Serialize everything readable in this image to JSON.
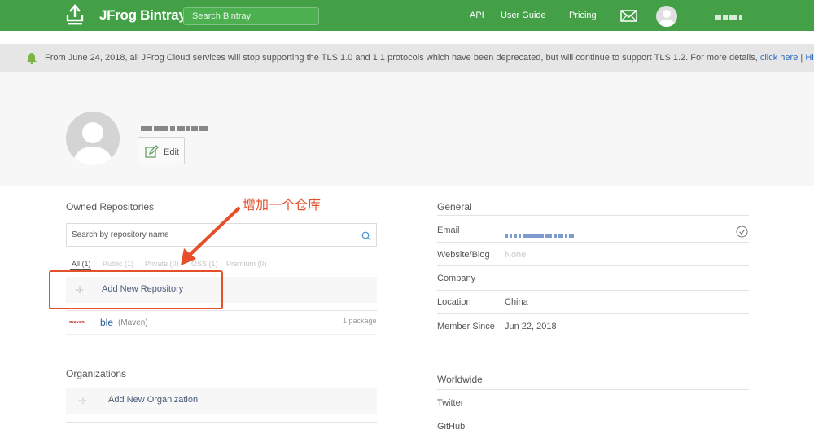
{
  "header": {
    "brand": "JFrog Bintray",
    "search_placeholder": "Search Bintray",
    "nav": [
      "API",
      "User Guide",
      "Pricing"
    ],
    "icons": [
      "upload-logo-icon",
      "mail-icon",
      "avatar"
    ],
    "brand_color": "#43a047"
  },
  "notice": {
    "text": "From June 24, 2018, all JFrog Cloud services will stop supporting the TLS 1.0 and 1.1 protocols which have been deprecated, but will continue to support TLS 1.2. For more details, ",
    "link": "click here",
    "separator": " | ",
    "hide": "Hide"
  },
  "profile": {
    "edit_label": "Edit"
  },
  "owned": {
    "title": "Owned Repositories",
    "search_placeholder": "Search by repository name",
    "filters": [
      "All (1)",
      "Public (1)",
      "Private (0)",
      "OSS (1)",
      "Premium (0)"
    ],
    "add_label": "Add New Repository",
    "repo": {
      "name": "ble",
      "type": "(Maven)",
      "count": "1 package",
      "logo": "maven"
    }
  },
  "orgs": {
    "title": "Organizations",
    "add_label": "Add New Organization"
  },
  "general": {
    "title": "General",
    "fields": [
      {
        "label": "Email",
        "value": ""
      },
      {
        "label": "Website/Blog",
        "value": "None"
      },
      {
        "label": "Company",
        "value": ""
      },
      {
        "label": "Location",
        "value": "China"
      },
      {
        "label": "Member Since",
        "value": "Jun 22, 2018"
      }
    ]
  },
  "worldwide": {
    "title": "Worldwide",
    "items": [
      "Twitter",
      "GitHub"
    ]
  },
  "annotation": {
    "text": "增加一个仓库",
    "color": "#e5502b"
  }
}
